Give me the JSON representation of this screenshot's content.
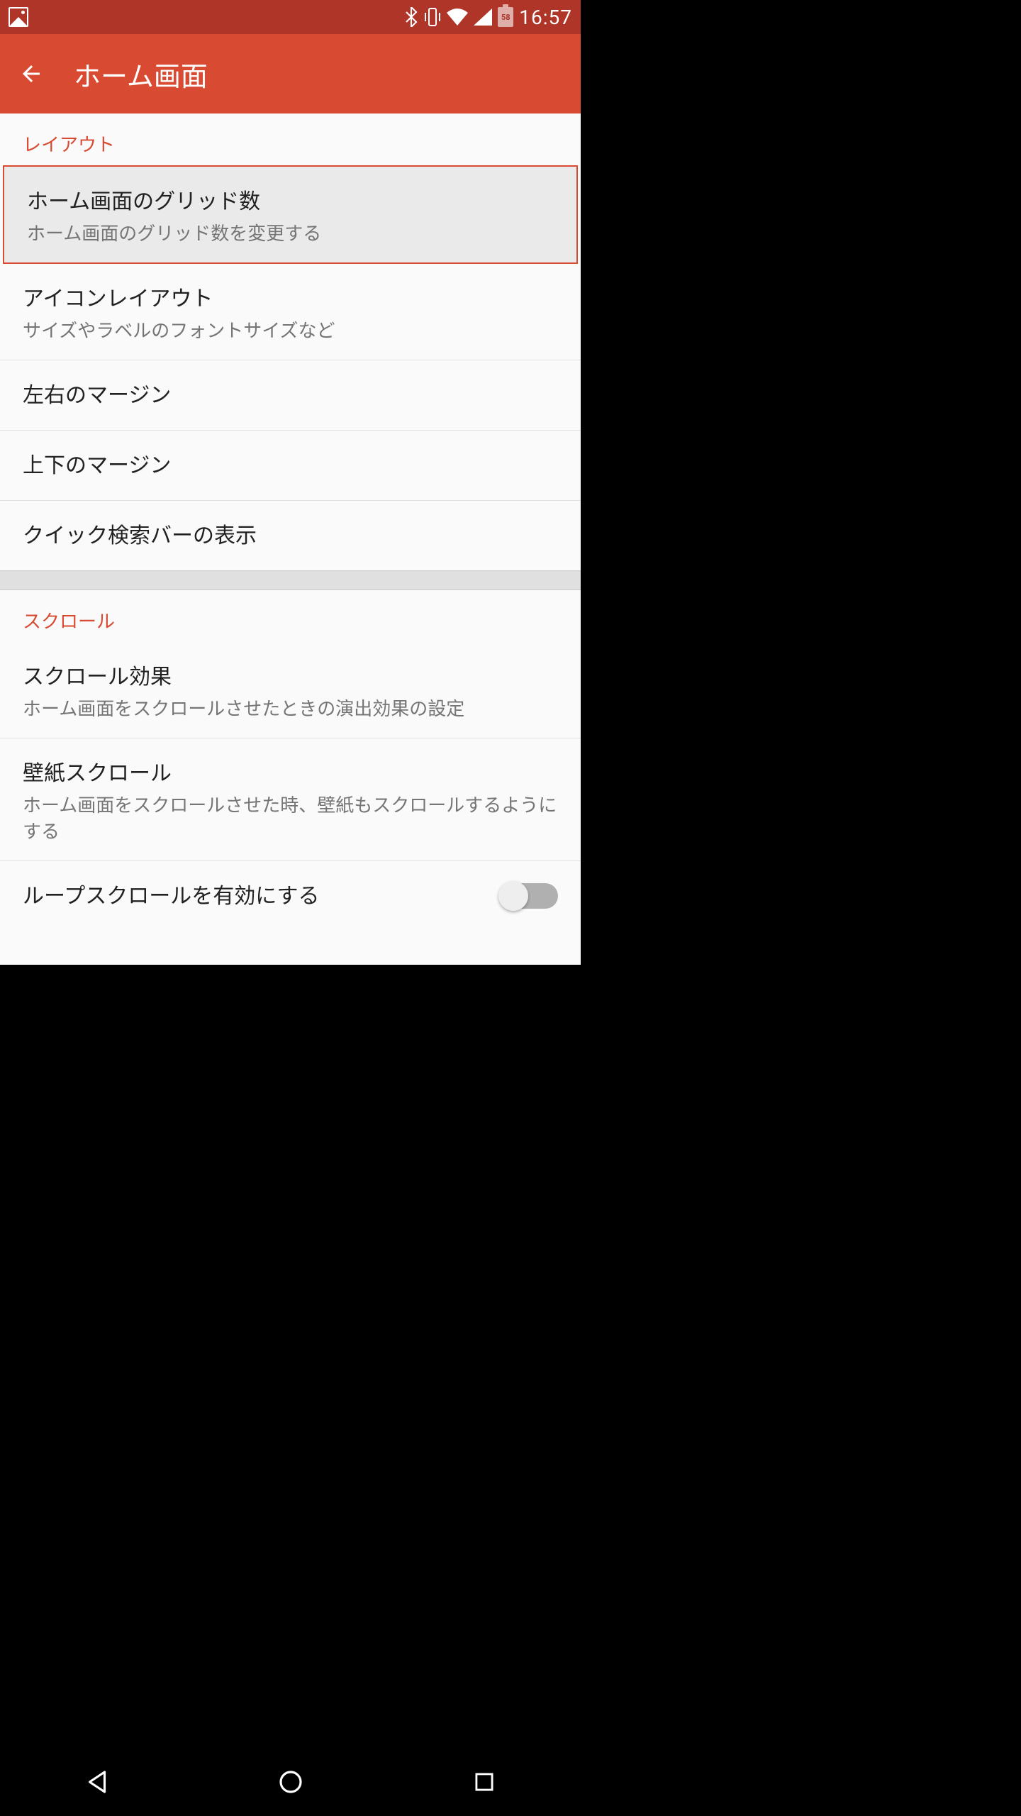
{
  "status_bar": {
    "time": "16:57",
    "battery_level": "58"
  },
  "app_bar": {
    "title": "ホーム画面"
  },
  "sections": {
    "layout": {
      "header": "レイアウト",
      "items": {
        "grid": {
          "title": "ホーム画面のグリッド数",
          "subtitle": "ホーム画面のグリッド数を変更する"
        },
        "icon_layout": {
          "title": "アイコンレイアウト",
          "subtitle": "サイズやラベルのフォントサイズなど"
        },
        "lr_margin": {
          "title": "左右のマージン"
        },
        "tb_margin": {
          "title": "上下のマージン"
        },
        "quick_search": {
          "title": "クイック検索バーの表示"
        }
      }
    },
    "scroll": {
      "header": "スクロール",
      "items": {
        "scroll_effect": {
          "title": "スクロール効果",
          "subtitle": "ホーム画面をスクロールさせたときの演出効果の設定"
        },
        "wallpaper_scroll": {
          "title": "壁紙スクロール",
          "subtitle": "ホーム画面をスクロールさせた時、壁紙もスクロールするようにする"
        },
        "loop_scroll": {
          "title": "ループスクロールを有効にする"
        }
      }
    }
  }
}
